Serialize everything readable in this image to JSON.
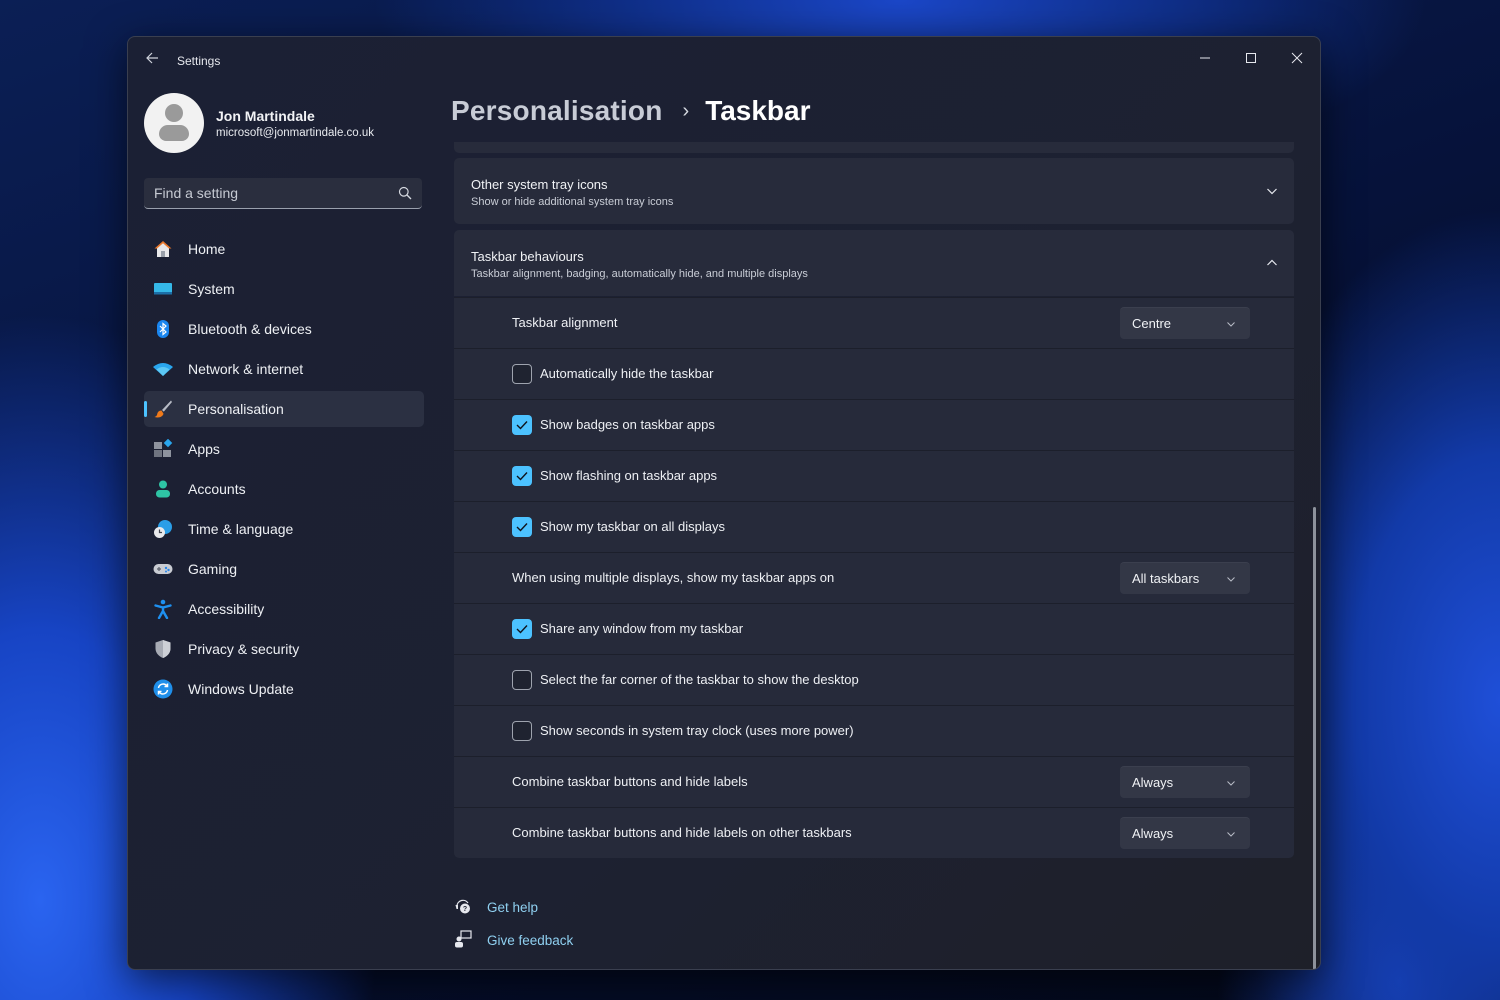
{
  "window": {
    "title": "Settings",
    "controls": {
      "minimize": "minimize",
      "maximize": "maximize",
      "close": "close"
    }
  },
  "profile": {
    "name": "Jon Martindale",
    "email": "microsoft@jonmartindale.co.uk"
  },
  "search": {
    "placeholder": "Find a setting",
    "value": ""
  },
  "sidebar": {
    "items": [
      {
        "label": "Home",
        "icon": "home-icon"
      },
      {
        "label": "System",
        "icon": "system-icon"
      },
      {
        "label": "Bluetooth & devices",
        "icon": "bluetooth-icon"
      },
      {
        "label": "Network & internet",
        "icon": "wifi-icon"
      },
      {
        "label": "Personalisation",
        "icon": "brush-icon",
        "active": true
      },
      {
        "label": "Apps",
        "icon": "apps-icon"
      },
      {
        "label": "Accounts",
        "icon": "accounts-icon"
      },
      {
        "label": "Time & language",
        "icon": "time-language-icon"
      },
      {
        "label": "Gaming",
        "icon": "gamepad-icon"
      },
      {
        "label": "Accessibility",
        "icon": "accessibility-icon"
      },
      {
        "label": "Privacy & security",
        "icon": "shield-icon"
      },
      {
        "label": "Windows Update",
        "icon": "update-icon"
      }
    ]
  },
  "breadcrumb": {
    "parent": "Personalisation",
    "separator": "›",
    "current": "Taskbar"
  },
  "sections": {
    "other_tray": {
      "title": "Other system tray icons",
      "subtitle": "Show or hide additional system tray icons",
      "expanded": false
    },
    "behaviours": {
      "title": "Taskbar behaviours",
      "subtitle": "Taskbar alignment, badging, automatically hide, and multiple displays",
      "expanded": true
    }
  },
  "settings": [
    {
      "type": "dropdown",
      "label": "Taskbar alignment",
      "value": "Centre"
    },
    {
      "type": "checkbox",
      "label": "Automatically hide the taskbar",
      "checked": false
    },
    {
      "type": "checkbox",
      "label": "Show badges on taskbar apps",
      "checked": true
    },
    {
      "type": "checkbox",
      "label": "Show flashing on taskbar apps",
      "checked": true
    },
    {
      "type": "checkbox",
      "label": "Show my taskbar on all displays",
      "checked": true
    },
    {
      "type": "dropdown",
      "label": "When using multiple displays, show my taskbar apps on",
      "value": "All taskbars"
    },
    {
      "type": "checkbox",
      "label": "Share any window from my taskbar",
      "checked": true
    },
    {
      "type": "checkbox",
      "label": "Select the far corner of the taskbar to show the desktop",
      "checked": false
    },
    {
      "type": "checkbox",
      "label": "Show seconds in system tray clock (uses more power)",
      "checked": false
    },
    {
      "type": "dropdown",
      "label": "Combine taskbar buttons and hide labels",
      "value": "Always"
    },
    {
      "type": "dropdown",
      "label": "Combine taskbar buttons and hide labels on other taskbars",
      "value": "Always"
    }
  ],
  "links": {
    "help": "Get help",
    "feedback": "Give feedback"
  },
  "colors": {
    "accent": "#4cc2ff",
    "link": "#8fd0f0",
    "window_bg": "#1c2030",
    "card_bg": "#272b3b"
  }
}
